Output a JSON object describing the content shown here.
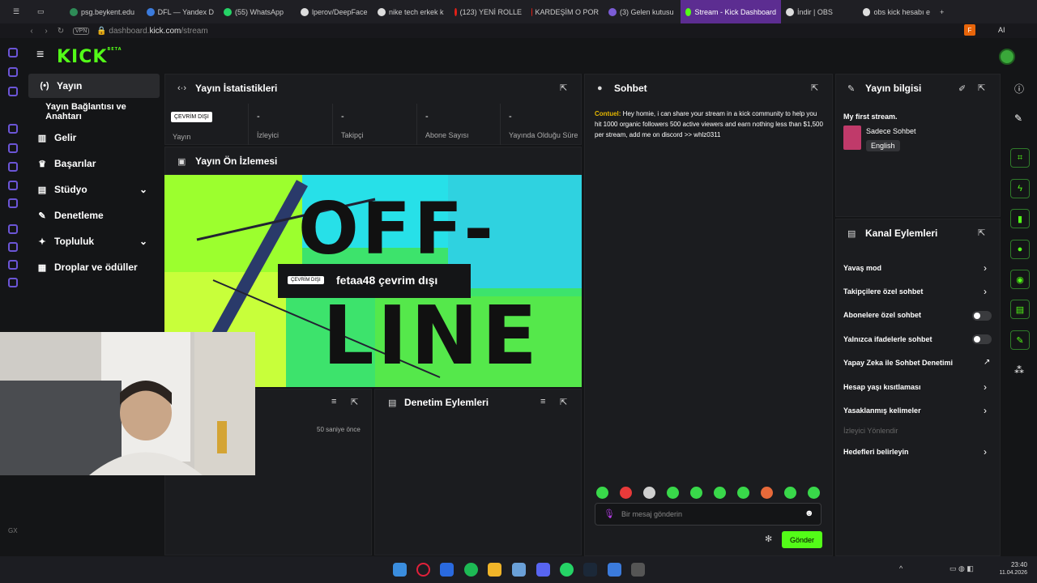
{
  "browser": {
    "tabs": [
      {
        "label": "psg.beykent.edu",
        "color": "#2e8b57"
      },
      {
        "label": "DFL — Yandex D",
        "color": "#3b7bdc"
      },
      {
        "label": "(55) WhatsApp",
        "color": "#25d366"
      },
      {
        "label": "lperov/DeepFace",
        "color": "#dddddd"
      },
      {
        "label": "nike tech erkek k",
        "color": "#dddddd"
      },
      {
        "label": "(123) YENİ ROLLE",
        "color": "#e62117"
      },
      {
        "label": "KARDEŞİM O POR",
        "color": "#e62117"
      },
      {
        "label": "(3) Gelen kutusu",
        "color": "#7b5cd6"
      },
      {
        "label": "Stream - Kick Dashboard",
        "color": "#53fc18"
      },
      {
        "label": "İndir | OBS",
        "color": "#dddddd"
      },
      {
        "label": "obs kick hesabı e",
        "color": "#dddddd"
      }
    ],
    "url_host": "dashboard.",
    "url_domain": "kick.com",
    "url_path": "/stream",
    "vpn_label": "VPN",
    "profile_initial": "F",
    "ai_label": "AI"
  },
  "logo": {
    "text": "KICK",
    "beta": "BETA"
  },
  "nav": {
    "items": [
      {
        "label": "Yayın",
        "icon": "broadcast-icon"
      },
      {
        "label": "Yayın Bağlantısı ve Anahtarı"
      },
      {
        "label": "Gelir",
        "icon": "chart-icon"
      },
      {
        "label": "Başarılar",
        "icon": "trophy-icon"
      },
      {
        "label": "Stüdyo",
        "icon": "studio-icon"
      },
      {
        "label": "Denetleme",
        "icon": "wrench-icon"
      },
      {
        "label": "Topluluk",
        "icon": "community-icon"
      },
      {
        "label": "Droplar ve ödüller",
        "icon": "gift-icon"
      }
    ]
  },
  "stats": {
    "title": "Yayın İstatistikleri",
    "status_badge": "ÇEVRİM DIŞI",
    "items": [
      {
        "value": "",
        "label": "Yayın"
      },
      {
        "value": "-",
        "label": "İzleyici"
      },
      {
        "value": "-",
        "label": "Takipçi"
      },
      {
        "value": "-",
        "label": "Abone Sayısı"
      },
      {
        "value": "-",
        "label": "Yayında Olduğu Süre"
      }
    ]
  },
  "preview": {
    "title": "Yayın Ön İzlemesi",
    "badge": "ÇEVRİM DIŞI",
    "offline_text": "fetaa48 çevrim dışı",
    "art_line1": "OFF-",
    "art_line2": "LINE"
  },
  "activity": {
    "time_ago": "50 saniye önce"
  },
  "moderation": {
    "title": "Denetim Eylemleri"
  },
  "chat": {
    "title": "Sohbet",
    "message_user": "Contuel:",
    "message_text": "Hey homie, i can share your stream in a kick community to help you hit 1000 organic followers 500 active viewers and earn nothing less than $1,500 per stream, add me on discord >> whlz0311",
    "input_placeholder": "Bir mesaj gönderin",
    "send_label": "Gönder"
  },
  "stream_info": {
    "title": "Yayın bilgisi",
    "stream_title": "My first stream.",
    "category": "Sadece Sohbet",
    "language": "English"
  },
  "channel_actions": {
    "title": "Kanal Eylemleri",
    "items": [
      {
        "label": "Yavaş mod",
        "control": "chevron"
      },
      {
        "label": "Takipçilere özel sohbet",
        "control": "chevron"
      },
      {
        "label": "Abonelere özel sohbet",
        "control": "toggle",
        "on": false
      },
      {
        "label": "Yalnızca ifadelerle sohbet",
        "control": "toggle",
        "on": false
      },
      {
        "label": "Yapay Zeka ile Sohbet Denetimi",
        "control": "external"
      },
      {
        "label": "Hesap yaşı kısıtlaması",
        "control": "chevron"
      },
      {
        "label": "Yasaklanmış kelimeler",
        "control": "chevron"
      },
      {
        "label": "İzleyici Yönlendir",
        "control": "none",
        "disabled": true
      },
      {
        "label": "Hedefleri belirleyin",
        "control": "chevron"
      }
    ]
  },
  "taskbar": {
    "time": "23:40",
    "date": "11.04.2026"
  },
  "colors": {
    "accent": "#53fc18",
    "panel": "#1b1c1f",
    "bg": "#141517"
  }
}
